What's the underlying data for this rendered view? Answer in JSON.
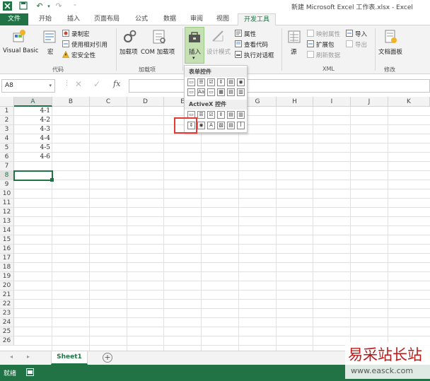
{
  "window": {
    "title": "新建 Microsoft Excel 工作表.xlsx - Excel"
  },
  "tabs": [
    {
      "label": "文件",
      "type": "file"
    },
    {
      "label": "开始",
      "type": "normal"
    },
    {
      "label": "插入",
      "type": "normal"
    },
    {
      "label": "页面布局",
      "type": "normal"
    },
    {
      "label": "公式",
      "type": "normal"
    },
    {
      "label": "数据",
      "type": "normal"
    },
    {
      "label": "审阅",
      "type": "normal"
    },
    {
      "label": "视图",
      "type": "normal"
    },
    {
      "label": "开发工具",
      "type": "active"
    }
  ],
  "ribbon": {
    "code": {
      "group_label": "代码",
      "visual_basic": "Visual Basic",
      "macro": "宏",
      "record_macro": "录制宏",
      "relative_ref": "使用相对引用",
      "macro_security": "宏安全性"
    },
    "addins": {
      "group_label": "加载项",
      "addins": "加载项",
      "com_addins": "COM 加载项"
    },
    "controls": {
      "insert": "插入",
      "design_mode": "设计模式",
      "properties": "属性",
      "view_code": "查看代码",
      "run_dialog": "执行对话框"
    },
    "xml": {
      "group_label": "XML",
      "source": "源",
      "map_props": "映射属性",
      "expansion": "扩展包",
      "refresh": "刷新数据",
      "import": "导入",
      "export": "导出"
    },
    "modify": {
      "group_label": "修改",
      "doc_panel": "文档面板"
    }
  },
  "dropdown": {
    "form_controls": "表单控件",
    "activex_controls": "ActiveX 控件"
  },
  "namebox": {
    "value": "A8"
  },
  "formula": {
    "fx": "fx"
  },
  "columns": [
    "A",
    "B",
    "C",
    "D",
    "E",
    "F",
    "G",
    "H",
    "I",
    "J",
    "K"
  ],
  "rows": [
    "1",
    "2",
    "3",
    "4",
    "5",
    "6",
    "7",
    "8",
    "9",
    "10",
    "11",
    "12",
    "13",
    "14",
    "15",
    "16",
    "17",
    "18",
    "19",
    "20",
    "21",
    "22",
    "23",
    "24",
    "25",
    "26"
  ],
  "cells_a": [
    "4-1",
    "4-2",
    "4-3",
    "4-4",
    "4-5",
    "4-6"
  ],
  "selected_cell": "A8",
  "sheets": [
    "Sheet1"
  ],
  "status": {
    "ready": "就绪"
  },
  "watermark": {
    "line1": "易采站长站",
    "line2": "www.easck.com"
  },
  "colors": {
    "accent": "#217346",
    "highlight": "#e53935"
  }
}
